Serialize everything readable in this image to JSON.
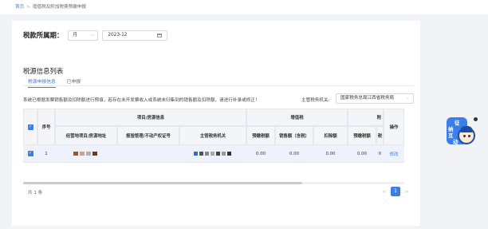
{
  "breadcrumb": {
    "home": "首页",
    "separator": ">",
    "current": "增值税及附加税费预缴申报"
  },
  "period": {
    "label": "税款所属期：",
    "unit": "月",
    "date": "2023-12"
  },
  "section": {
    "title": "税源信息列表"
  },
  "tabs": [
    {
      "label": "税源申报信息",
      "active": true
    },
    {
      "label": "已申报",
      "active": false
    }
  ],
  "notice": "系统已根据发票销售额及扣除额进行预填，若存在未开发票收入或系统未归集到的销售额及扣除额，请进行补录或修正！",
  "authority": {
    "label": "主管税务机关:",
    "value": "国家税务总局江西省税务局"
  },
  "table": {
    "group_headers": {
      "project": "项目/房源信息",
      "vat": "增值税",
      "other_fragment": "附"
    },
    "headers": {
      "seq": "序号",
      "address": "经营地项目/房源地址",
      "permit": "报验管理/不动产权证号",
      "authority": "主管税务机关",
      "prepaid_tax": "预缴税额",
      "sales_amount": "销售额（含税）",
      "deduction": "扣除额",
      "prepaid_tax2": "预缴税额",
      "cut_fragment": "税",
      "action": "操作"
    },
    "rows": [
      {
        "seq": "1",
        "address": "",
        "permit": "",
        "authority": "",
        "prepaid_tax": "0.00",
        "sales_amount": "0.00",
        "deduction": "0.00",
        "prepaid_tax2": "0.00",
        "cut_fragment": "0",
        "action": "修改"
      }
    ]
  },
  "footer": {
    "total": "共 1 条",
    "current_page": "1",
    "prev": "<",
    "next": ">"
  },
  "assistant": {
    "line1": "征",
    "line2": "纳",
    "line3": "互",
    "line4": "动"
  },
  "colors": {
    "accent": "#3b7de9",
    "header_bg": "#f3f5f8",
    "row_highlight": "#eef3fb"
  }
}
